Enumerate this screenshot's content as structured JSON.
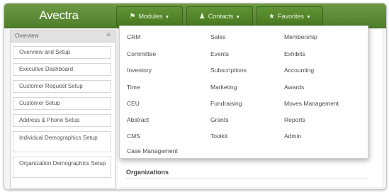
{
  "app": {
    "logo": "Avectra"
  },
  "nav": {
    "modules": {
      "label": "Modules",
      "icon": "puzzle-icon"
    },
    "contacts": {
      "label": "Contacts",
      "icon": "person-icon"
    },
    "favorites": {
      "label": "Favorites",
      "icon": "star-icon"
    }
  },
  "sidebar": {
    "header": "Overview",
    "items": [
      "Overview and Setup",
      "Executive Dashboard",
      "Customer Request Setup",
      "Customer Setup",
      "Address & Phone Setup",
      "Individual Demographics Setup",
      "Organization Demographics Setup"
    ]
  },
  "dropdown": {
    "columns": [
      [
        "CRM",
        "Committee",
        "Inventory",
        "Time",
        "CEU",
        "Abstract",
        "CMS",
        "Case Management"
      ],
      [
        "Sales",
        "Events",
        "Subscriptions",
        "Marketing",
        "Fundraising",
        "Grants",
        "Toolkit"
      ],
      [
        "Membership",
        "Exhibits",
        "Accounting",
        "Awards",
        "Moves Management",
        "Reports",
        "Admin"
      ]
    ]
  },
  "main": {
    "section_label": "Organizations"
  },
  "colors": {
    "topbar": "#5a8a33",
    "accent_green": "#6b9a2e"
  }
}
